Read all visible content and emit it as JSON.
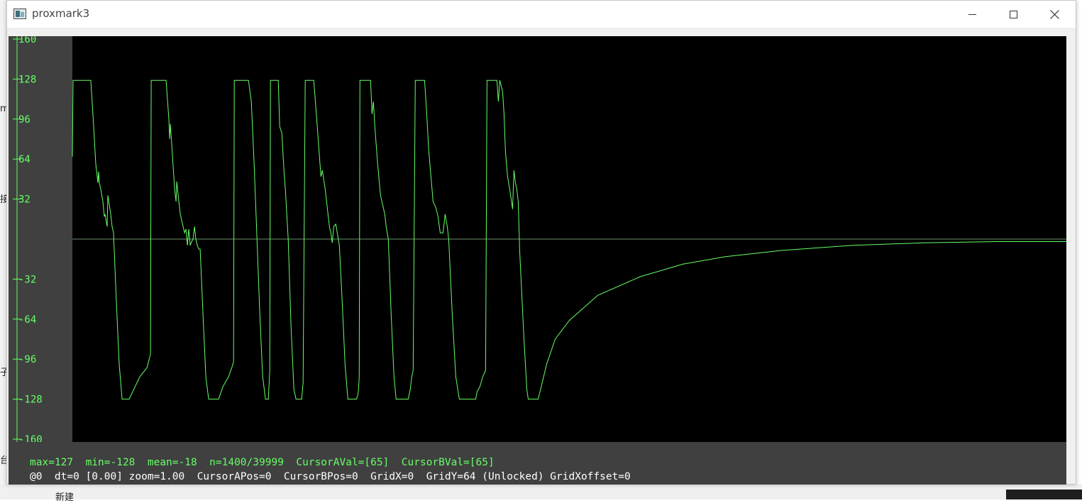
{
  "window": {
    "title": "proxmark3"
  },
  "background_fragments": [
    "m",
    "接",
    "子",
    "台",
    "新建"
  ],
  "colors": {
    "trace": "#66ff66",
    "axis": "#66ff66",
    "plot_bg": "#000000",
    "frame_bg": "#404040",
    "status_info": "#66ff66",
    "status_cursor": "#ffffff"
  },
  "icons": {
    "app": "proxmark-app-icon",
    "minimize": "minimize-icon",
    "maximize": "maximize-icon",
    "close": "close-icon"
  },
  "chart_data": {
    "type": "line",
    "title": "",
    "xlabel": "",
    "ylabel": "",
    "ylim": [
      -160,
      160
    ],
    "xlim": [
      0,
      1400
    ],
    "y_ticks": [
      160,
      128,
      96,
      64,
      32,
      -32,
      -64,
      -96,
      -128,
      -160
    ],
    "grid": false,
    "zero_line": true,
    "series": [
      {
        "points": [
          [
            0,
            66
          ],
          [
            1,
            127
          ],
          [
            26,
            127
          ],
          [
            30,
            90
          ],
          [
            33,
            60
          ],
          [
            36,
            45
          ],
          [
            37,
            54
          ],
          [
            38,
            45
          ],
          [
            40,
            40
          ],
          [
            43,
            30
          ],
          [
            45,
            18
          ],
          [
            46,
            20
          ],
          [
            49,
            10
          ],
          [
            50,
            35
          ],
          [
            54,
            20
          ],
          [
            56,
            10
          ],
          [
            58,
            5
          ],
          [
            62,
            -50
          ],
          [
            66,
            -100
          ],
          [
            70,
            -128
          ],
          [
            80,
            -128
          ],
          [
            85,
            -122
          ],
          [
            95,
            -110
          ],
          [
            105,
            -103
          ],
          [
            110,
            -92
          ],
          [
            111,
            127
          ],
          [
            132,
            127
          ],
          [
            136,
            95
          ],
          [
            137,
            80
          ],
          [
            138,
            92
          ],
          [
            140,
            75
          ],
          [
            144,
            40
          ],
          [
            146,
            30
          ],
          [
            147,
            46
          ],
          [
            150,
            30
          ],
          [
            152,
            20
          ],
          [
            154,
            15
          ],
          [
            156,
            10
          ],
          [
            158,
            5
          ],
          [
            160,
            8
          ],
          [
            162,
            -5
          ],
          [
            164,
            8
          ],
          [
            166,
            -5
          ],
          [
            168,
            -2
          ],
          [
            170,
            0
          ],
          [
            172,
            10
          ],
          [
            174,
            0
          ],
          [
            176,
            -5
          ],
          [
            178,
            -8
          ],
          [
            180,
            -8
          ],
          [
            184,
            -60
          ],
          [
            188,
            -110
          ],
          [
            192,
            -128
          ],
          [
            206,
            -128
          ],
          [
            212,
            -118
          ],
          [
            220,
            -110
          ],
          [
            225,
            -102
          ],
          [
            227,
            -98
          ],
          [
            228,
            127
          ],
          [
            248,
            127
          ],
          [
            252,
            110
          ],
          [
            256,
            60
          ],
          [
            260,
            0
          ],
          [
            264,
            -60
          ],
          [
            268,
            -110
          ],
          [
            272,
            -128
          ],
          [
            276,
            -128
          ],
          [
            278,
            -105
          ],
          [
            279,
            127
          ],
          [
            290,
            127
          ],
          [
            292,
            90
          ],
          [
            295,
            85
          ],
          [
            298,
            55
          ],
          [
            300,
            40
          ],
          [
            302,
            20
          ],
          [
            304,
            0
          ],
          [
            308,
            -70
          ],
          [
            312,
            -120
          ],
          [
            315,
            -128
          ],
          [
            323,
            -128
          ],
          [
            325,
            -115
          ],
          [
            328,
            127
          ],
          [
            340,
            127
          ],
          [
            345,
            90
          ],
          [
            350,
            50
          ],
          [
            352,
            55
          ],
          [
            356,
            40
          ],
          [
            358,
            30
          ],
          [
            360,
            20
          ],
          [
            362,
            10
          ],
          [
            364,
            5
          ],
          [
            366,
            -3
          ],
          [
            368,
            10
          ],
          [
            371,
            12
          ],
          [
            373,
            5
          ],
          [
            376,
            -5
          ],
          [
            380,
            -50
          ],
          [
            384,
            -100
          ],
          [
            388,
            -128
          ],
          [
            400,
            -128
          ],
          [
            402,
            -125
          ],
          [
            403,
            -120
          ],
          [
            404,
            -110
          ],
          [
            405,
            127
          ],
          [
            420,
            127
          ],
          [
            422,
            100
          ],
          [
            424,
            110
          ],
          [
            426,
            90
          ],
          [
            430,
            60
          ],
          [
            434,
            35
          ],
          [
            438,
            25
          ],
          [
            440,
            20
          ],
          [
            442,
            10
          ],
          [
            445,
            0
          ],
          [
            449,
            -60
          ],
          [
            453,
            -110
          ],
          [
            456,
            -128
          ],
          [
            473,
            -128
          ],
          [
            476,
            -120
          ],
          [
            478,
            -110
          ],
          [
            480,
            -105
          ],
          [
            483,
            127
          ],
          [
            496,
            127
          ],
          [
            498,
            110
          ],
          [
            502,
            70
          ],
          [
            505,
            50
          ],
          [
            508,
            30
          ],
          [
            512,
            25
          ],
          [
            515,
            18
          ],
          [
            518,
            5
          ],
          [
            522,
            5
          ],
          [
            525,
            20
          ],
          [
            528,
            10
          ],
          [
            530,
            0
          ],
          [
            535,
            -60
          ],
          [
            540,
            -110
          ],
          [
            545,
            -128
          ],
          [
            568,
            -128
          ],
          [
            570,
            -122
          ],
          [
            574,
            -118
          ],
          [
            578,
            -110
          ],
          [
            582,
            -105
          ],
          [
            584,
            127
          ],
          [
            598,
            127
          ],
          [
            600,
            110
          ],
          [
            602,
            127
          ],
          [
            606,
            118
          ],
          [
            608,
            100
          ],
          [
            610,
            70
          ],
          [
            613,
            50
          ],
          [
            616,
            40
          ],
          [
            620,
            24
          ],
          [
            622,
            55
          ],
          [
            624,
            45
          ],
          [
            626,
            40
          ],
          [
            628,
            30
          ],
          [
            630,
            -10
          ],
          [
            636,
            -80
          ],
          [
            640,
            -120
          ],
          [
            642,
            -128
          ],
          [
            656,
            -128
          ],
          [
            668,
            -100
          ],
          [
            680,
            -80
          ],
          [
            700,
            -65
          ],
          [
            740,
            -45
          ],
          [
            800,
            -30
          ],
          [
            860,
            -20
          ],
          [
            920,
            -14
          ],
          [
            1000,
            -9
          ],
          [
            1100,
            -5
          ],
          [
            1200,
            -3
          ],
          [
            1300,
            -2
          ],
          [
            1400,
            -2
          ]
        ]
      }
    ]
  },
  "status": {
    "info_line": "max=127  min=-128  mean=-18  n=1400/39999  CursorAVal=[65]  CursorBVal=[65]",
    "cursor_line": "@0  dt=0 [0.00] zoom=1.00  CursorAPos=0  CursorBPos=0  GridX=0  GridY=64 (Unlocked) GridXoffset=0"
  }
}
